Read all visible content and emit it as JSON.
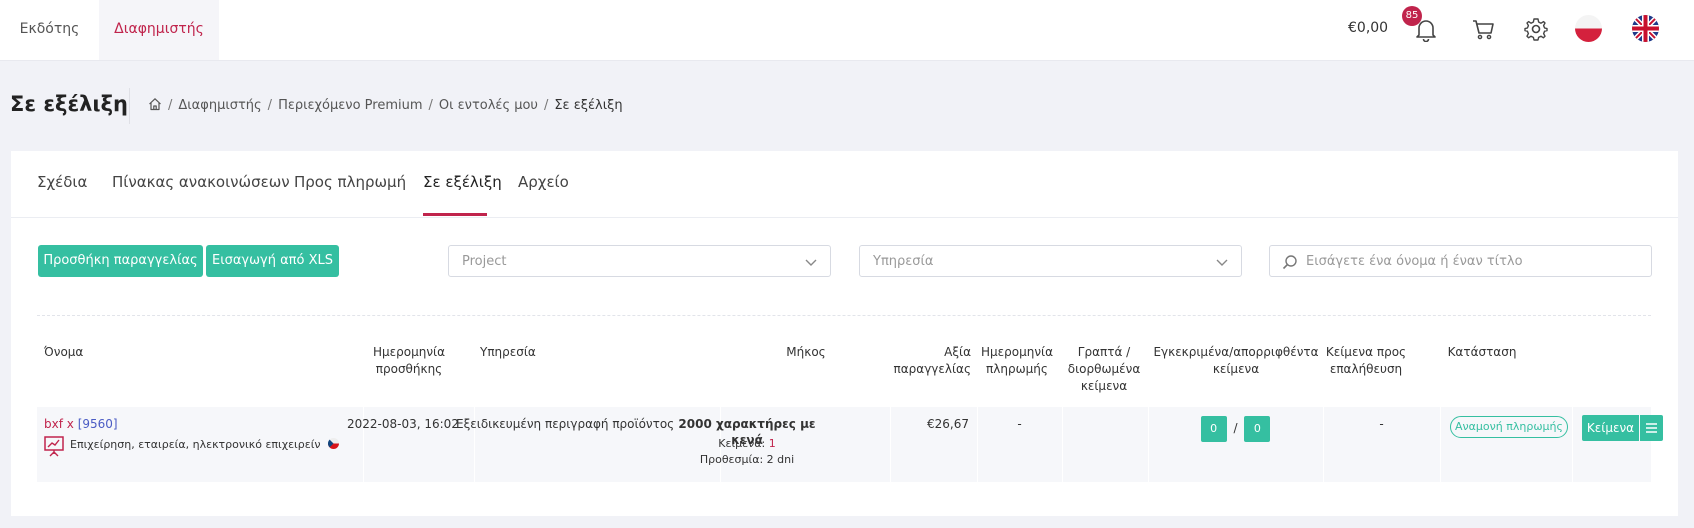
{
  "topbar": {
    "role_tabs": [
      "Εκδότης",
      "Διαφημιστής"
    ],
    "balance": "€0,00",
    "notifications_count": "85",
    "icons": [
      "bell-icon",
      "cart-icon",
      "gear-icon",
      "flag-pl-icon",
      "flag-uk-icon"
    ]
  },
  "page": {
    "title": "Σε εξέλιξη",
    "breadcrumb": [
      "Διαφημιστής",
      "Περιεχόμενο Premium",
      "Οι εντολές μου",
      "Σε εξέλιξη"
    ]
  },
  "tabs": [
    "Σχέδια",
    "Πίνακας ανακοινώσεων",
    "Προς πληρωμή",
    "Σε εξέλιξη",
    "Αρχείο"
  ],
  "active_tab": "Σε εξέλιξη",
  "toolbar": {
    "add_order": "Προσθήκη παραγγελίας",
    "import_xls": "Εισαγωγή από XLS",
    "project_placeholder": "Project",
    "service_placeholder": "Υπηρεσία",
    "search_placeholder": "Εισάγετε ένα όνομα ή έναν τίτλο"
  },
  "table": {
    "headers": {
      "name": "Όνομα",
      "date_added": [
        "Ημερομηνία",
        "προσθήκης"
      ],
      "service": "Υπηρεσία",
      "length": "Μήκος",
      "order_value": [
        "Αξία",
        "παραγγελίας"
      ],
      "payment_date": [
        "Ημερομηνία",
        "πληρωμής"
      ],
      "written": [
        "Γραπτά /",
        "διορθωμένα",
        "κείμενα"
      ],
      "approved": [
        "Εγκεκριμένα/απορριφθέντα",
        "κείμενα"
      ],
      "to_verify": [
        "Κείμενα προς",
        "επαλήθευση"
      ],
      "status": "Κατάσταση"
    },
    "rows": [
      {
        "name": "bxf x",
        "id": "[9560]",
        "category": "Επιχείρηση, εταιρεία, ηλεκτρονικό επιχειρείν",
        "date_added": "2022-08-03, 16:02",
        "service": "Εξειδικευμένη περιγραφή προϊόντος",
        "length": "2000 χαρακτήρες με κενά",
        "texts_label": "Κείμενα:",
        "texts_count": "1",
        "deadline": "Προθεσμία: 2 dni",
        "value": "€26,67",
        "payment_date": "-",
        "written": "",
        "approved": "0",
        "rejected": "0",
        "approved_sep": "/",
        "to_verify": "-",
        "status": "Αναμονή πληρωμής",
        "action_label": "Κείμενα"
      }
    ]
  }
}
